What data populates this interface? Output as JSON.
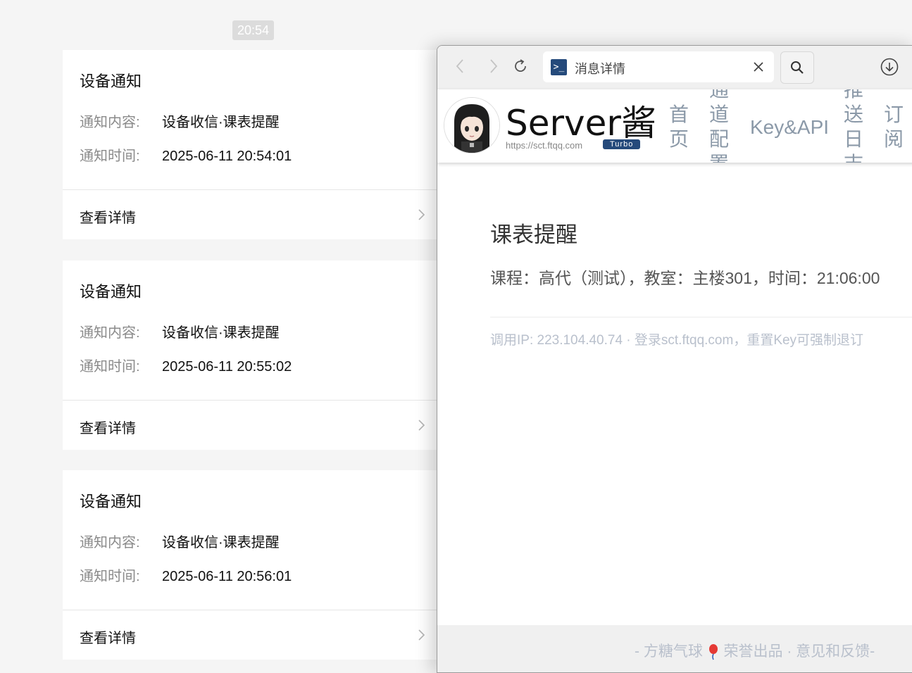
{
  "timestamp": "20:54",
  "cards": [
    {
      "title": "设备通知",
      "content_label": "通知内容:",
      "content_value": "设备收信·课表提醒",
      "time_label": "通知时间:",
      "time_value": "2025-06-11 20:54:01",
      "detail_label": "查看详情"
    },
    {
      "title": "设备通知",
      "content_label": "通知内容:",
      "content_value": "设备收信·课表提醒",
      "time_label": "通知时间:",
      "time_value": "2025-06-11 20:55:02",
      "detail_label": "查看详情"
    },
    {
      "title": "设备通知",
      "content_label": "通知内容:",
      "content_value": "设备收信·课表提醒",
      "time_label": "通知时间:",
      "time_value": "2025-06-11 20:56:01",
      "detail_label": "查看详情"
    }
  ],
  "browser": {
    "tab_title": "消息详情",
    "favicon_glyph": ">_",
    "icons": [
      "back-icon",
      "forward-icon",
      "reload-icon",
      "close-icon",
      "search-icon",
      "download-icon"
    ]
  },
  "site": {
    "logo_title": "Server酱",
    "logo_url": "https://sct.ftqq.com",
    "logo_badge": "Turbo",
    "nav": [
      "首页",
      "通道配置",
      "Key&API",
      "推送日志",
      "订阅"
    ]
  },
  "message": {
    "title": "课表提醒",
    "body": "课程：高代（测试），教室：主楼301，时间：21:06:00",
    "meta": "调用IP: 223.104.40.74 · 登录sct.ftqq.com，重置Key可强制退订"
  },
  "footer": {
    "left": "- 方糖气球",
    "right": "荣誉出品 · 意见和反馈-"
  },
  "colors": {
    "brand": "#254a7b",
    "nav": "#8b99a8",
    "meta": "#b9c0cc"
  }
}
